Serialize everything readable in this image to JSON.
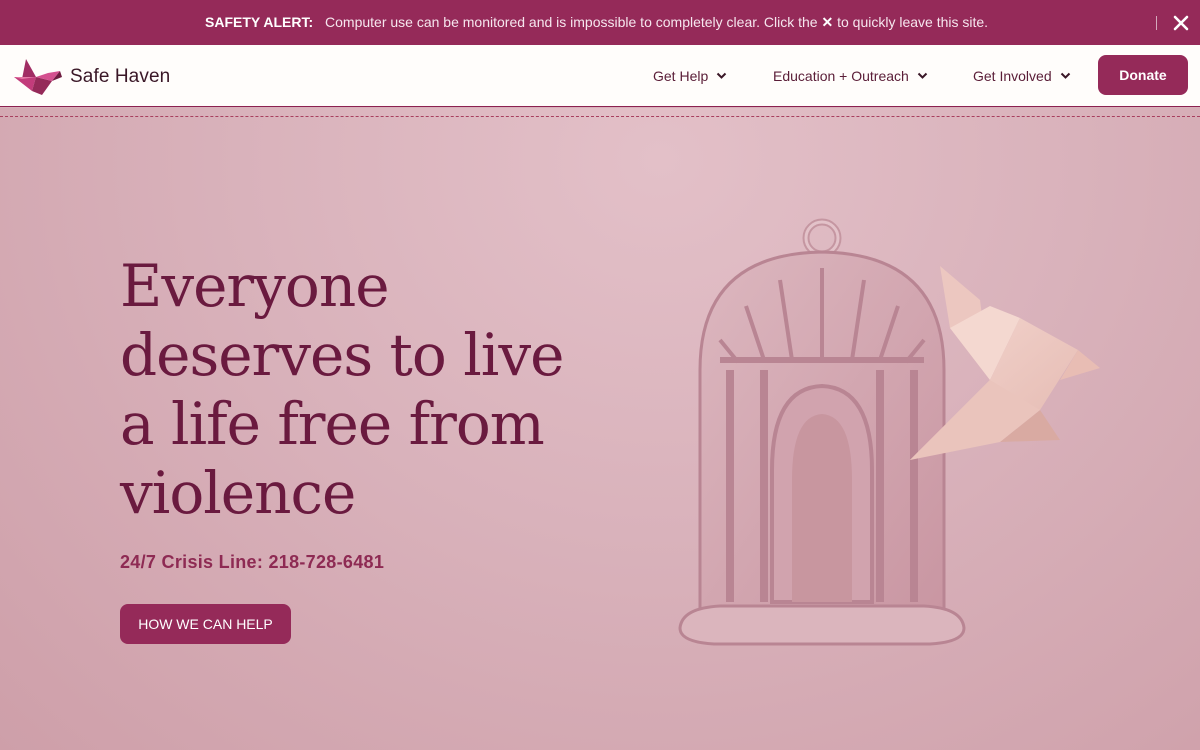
{
  "alert": {
    "label": "SAFETY ALERT:",
    "message_before": "Computer use can be monitored and is impossible to completely clear. Click the",
    "inline_x": "✕",
    "message_after": "to quickly leave this site.",
    "close_icon": "close-icon"
  },
  "header": {
    "brand": "Safe Haven",
    "logo_icon": "bird-logo-icon",
    "nav": [
      {
        "label": "Get Help",
        "icon": "chevron-down-icon"
      },
      {
        "label": "Education + Outreach",
        "icon": "chevron-down-icon"
      },
      {
        "label": "Get Involved",
        "icon": "chevron-down-icon"
      }
    ],
    "donate_label": "Donate"
  },
  "hero": {
    "headline_lines": [
      "Everyone",
      "deserves to live",
      "a life free from",
      "violence"
    ],
    "crisis_line": "24/7 Crisis Line: 218-728-6481",
    "cta_label": "HOW WE CAN HELP",
    "illustration": "birdcage-with-origami-dove"
  },
  "colors": {
    "brand": "#952a59",
    "headline": "#6a1a3f",
    "background": "#d9b0ba"
  }
}
